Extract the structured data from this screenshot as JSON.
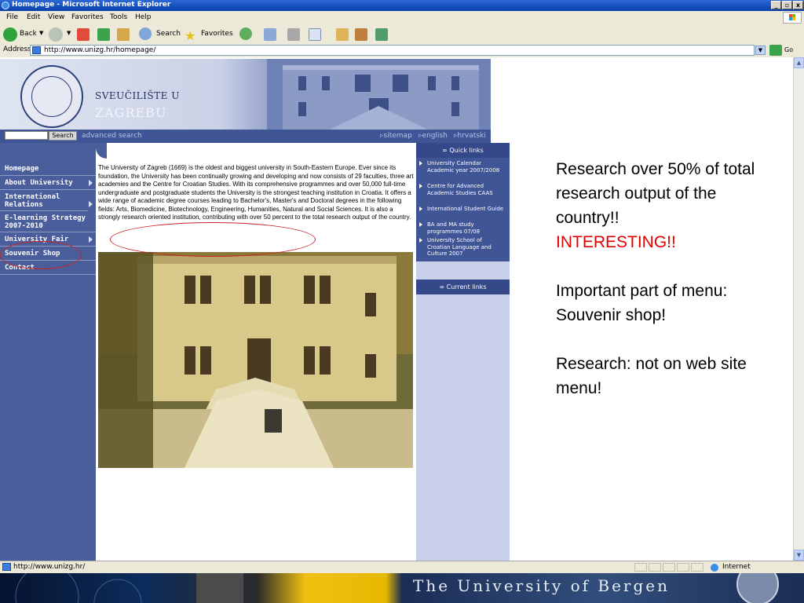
{
  "window": {
    "title": "Homepage - Microsoft Internet Explorer"
  },
  "menu": [
    "File",
    "Edit",
    "View",
    "Favorites",
    "Tools",
    "Help"
  ],
  "toolbar": {
    "back": "Back",
    "search": "Search",
    "favorites": "Favorites"
  },
  "address": {
    "label": "Address",
    "url": "http://www.unizg.hr/homepage/",
    "go": "Go"
  },
  "site": {
    "name_line1": "SVEUČILIŠTE U",
    "name_line2": "ZAGREBU",
    "search_button": "Search",
    "advanced_search": "advanced search",
    "top_links": [
      "sitemap",
      "english",
      "hrvatski"
    ],
    "nav": [
      "Homepage",
      "About University",
      "International Relations",
      "E-learning Strategy 2007-2010",
      "University Fair",
      "Souvenir Shop",
      "Contact"
    ],
    "intro": "The University of Zagreb (1669) is the oldest and biggest university in South-Eastern Europe. Ever since its foundation, the University has been continually growing and developing and now consists of 29 faculties, three art academies and the Centre for Croatian Studies. With its comprehensive programmes and over 50,000 full-time undergraduate and postgraduate students the University is the strongest teaching institution in Croatia.  It offers a wide range of academic degree courses leading to Bachelor's, Master's and Doctoral degrees in the following fields: Arts, Biomedicine, Biotechnology, Engineering, Humanities, Natural and Social Sciences. It is also a strongly research oriented institution, contributing with over 50 percent to the total research output of the country.",
    "quick_links_title": "Quick links",
    "quick_links": [
      "University Calendar Academic year 2007/2008",
      "Centre for Advanced Academic Studies CAAS",
      "International Student Guide",
      "BA and MA study programmes 07/08",
      "University School of Croatian Language and Culture 2007"
    ],
    "current_links_title": "Current links"
  },
  "annotation": {
    "line1": "Research over 50% of total research output of the country!!",
    "line2": "INTERESTING!!",
    "line3": "Important part of menu:",
    "line4": "Souvenir shop!",
    "line5": "Research: not on web site menu!"
  },
  "status": {
    "url": "http://www.unizg.hr/",
    "zone": "Internet"
  },
  "banner": {
    "text": "The University of Bergen"
  },
  "colors": {
    "accent_red": "#e00000",
    "nav_blue": "#4a5e9b",
    "title_blue": "#0a3fa8"
  }
}
